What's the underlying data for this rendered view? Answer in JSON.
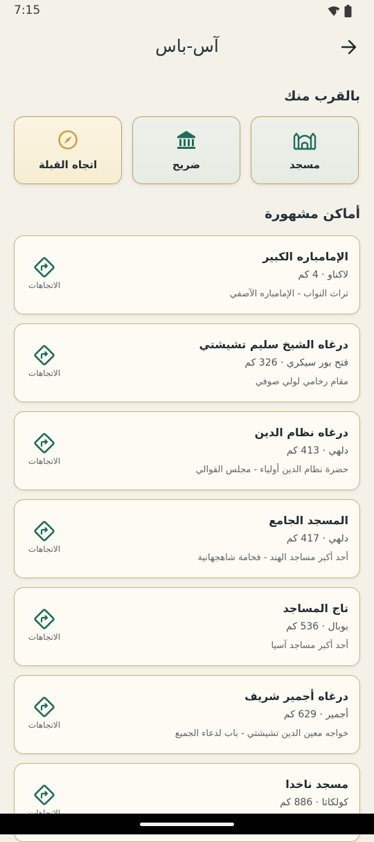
{
  "status": {
    "time": "7:15"
  },
  "app": {
    "title": "آس-باس"
  },
  "sections": {
    "nearby": "بالقرب منك",
    "famous": "أماكن مشهورة"
  },
  "quick": [
    {
      "label": "مسجد",
      "icon": "mosque-icon"
    },
    {
      "label": "ضريح",
      "icon": "shrine-icon"
    },
    {
      "label": "اتجاه القبلة",
      "icon": "compass-icon"
    }
  ],
  "directions_label": "الاتجاهات",
  "places": [
    {
      "name": "الإمامباره الكبير",
      "sub": "لاكناو · 4 كم",
      "desc": "تراث النواب - الإمامباره الآصفي"
    },
    {
      "name": "درغاه الشيخ سليم تشيشتي",
      "sub": "فتح بور سيكري · 326 كم",
      "desc": "مقام رخامي لولي صوفي"
    },
    {
      "name": "درغاه نظام الدين",
      "sub": "دلهي · 413 كم",
      "desc": "حضرة نظام الدين أولياء - مجلس القوالي"
    },
    {
      "name": "المسجد الجامع",
      "sub": "دلهي · 417 كم",
      "desc": "أحد أكبر مساجد الهند - فخامة شاهجهانية"
    },
    {
      "name": "تاج المساجد",
      "sub": "بوبال · 536 كم",
      "desc": "أحد أكبر مساجد آسيا"
    },
    {
      "name": "درغاه أجمير شريف",
      "sub": "أجمير · 629 كم",
      "desc": "خواجه معين الدين تشيشتي - باب لدعاء الجميع"
    },
    {
      "name": "مسجد ناخدا",
      "sub": "كولكاتا · 886 كم",
      "desc": ""
    }
  ],
  "colors": {
    "accent": "#1f6b5c",
    "border_gold": "#c9b37a",
    "background": "#f4f1e8"
  }
}
